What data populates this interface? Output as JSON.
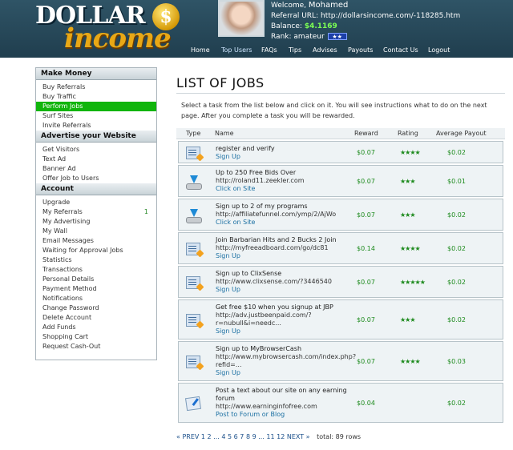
{
  "logo": {
    "top_text": "DOLLAR",
    "coin_glyph": "$",
    "bottom_text": "income"
  },
  "user": {
    "welcome_label": "Welcome,",
    "name": "Mohamed",
    "referral_label": "Referral URL:",
    "referral_url": "http://dollarsincome.com/-118285.htm",
    "balance_label": "Balance:",
    "balance": "$4.1169",
    "rank_label": "Rank:",
    "rank": "amateur",
    "rank_badge": "★★"
  },
  "nav": [
    "Home",
    "Top Users",
    "FAQs",
    "Tips",
    "Advises",
    "Payouts",
    "Contact Us",
    "Logout"
  ],
  "sidebar": {
    "make_money": {
      "title": "Make Money",
      "items": [
        "Buy Referrals",
        "Buy Traffic",
        "Perform Jobs",
        "Surf Sites",
        "Invite Referrals"
      ],
      "active": "Perform Jobs"
    },
    "advertise": {
      "title": "Advertise your Website",
      "items": [
        "Get Visitors",
        "Text Ad",
        "Banner Ad",
        "Offer Job to Users"
      ]
    },
    "account": {
      "title": "Account",
      "items": [
        "Upgrade",
        "My Referrals",
        "My Advertising",
        "My Wall",
        "Email Messages",
        "Waiting for Approval Jobs",
        "Statistics",
        "Transactions",
        "Personal Details",
        "Payment Method",
        "Notifications",
        "Change Password",
        "Delete Account",
        "Add Funds",
        "Shopping Cart",
        "Request Cash-Out"
      ],
      "referrals_count": "1"
    }
  },
  "main": {
    "title": "LIST OF JOBS",
    "intro": "Select a task from the list below and click on it. You will see instructions what to do on the next page. After you complete a task you will be rewarded.",
    "columns": [
      "Type",
      "Name",
      "Reward",
      "Rating",
      "Average Payout"
    ],
    "jobs": [
      {
        "icon": "document-icon",
        "title": "register and verify",
        "url": "",
        "action": "Sign Up",
        "reward": "$0.07",
        "rating": "★★★★",
        "avg": "$0.02"
      },
      {
        "icon": "download-icon",
        "title": "Up to 250 Free Bids Over",
        "url": "http://roland11.zeekler.com",
        "action": "Click on Site",
        "reward": "$0.07",
        "rating": "★★★",
        "avg": "$0.01"
      },
      {
        "icon": "download-icon",
        "title": "Sign up to 2 of my programs",
        "url": "http://affiliatefunnel.com/ymp/2/AjWo",
        "action": "Click on Site",
        "reward": "$0.07",
        "rating": "★★★",
        "avg": "$0.02"
      },
      {
        "icon": "document-icon",
        "title": "Join Barbarian Hits and 2 Bucks 2 Join",
        "url": "http://myfreeadboard.com/go/dc81",
        "action": "Sign Up",
        "reward": "$0.14",
        "rating": "★★★★",
        "avg": "$0.02"
      },
      {
        "icon": "document-icon",
        "title": "Sign up to ClixSense",
        "url": "http://www.clixsense.com/?3446540",
        "action": "Sign Up",
        "reward": "$0.07",
        "rating": "★★★★★",
        "avg": "$0.02"
      },
      {
        "icon": "document-icon",
        "title": "Get free $10 when you signup at JBP",
        "url": "http://adv.justbeenpaid.com/?r=nubull&i=needc...",
        "action": "Sign Up",
        "reward": "$0.07",
        "rating": "★★★",
        "avg": "$0.02"
      },
      {
        "icon": "document-icon",
        "title": "Sign up to MyBrowserCash",
        "url": "http://www.mybrowsercash.com/index.php?refid=...",
        "action": "Sign Up",
        "reward": "$0.07",
        "rating": "★★★★",
        "avg": "$0.03"
      },
      {
        "icon": "note-icon",
        "title": "Post a text about our site on any earning forum",
        "url": "http://www.earninginfofree.com",
        "action": "Post to Forum or Blog",
        "reward": "$0.04",
        "rating": "",
        "avg": "$0.02"
      }
    ],
    "pager": {
      "prev": "« PREV",
      "pages": [
        "1",
        "2",
        "...",
        "4",
        "5",
        "6",
        "7",
        "8",
        "9",
        "...",
        "11",
        "12"
      ],
      "next": "NEXT »",
      "total": "total: 89 rows"
    }
  }
}
